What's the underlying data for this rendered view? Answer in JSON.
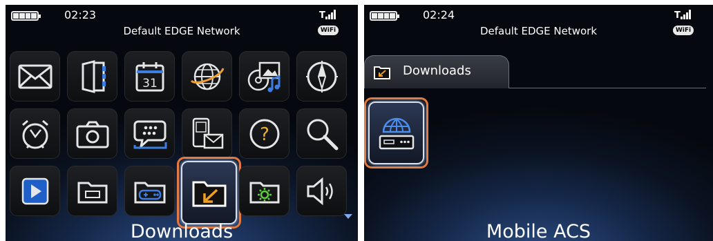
{
  "left_screen": {
    "status": {
      "time": "02:23",
      "network": "Default EDGE Network",
      "wifi_badge": "WiFi"
    },
    "apps": [
      {
        "row": 1,
        "items": [
          "envelope-icon",
          "contacts-book-icon",
          "calendar-icon",
          "browser-globe-icon",
          "media-icon",
          "compass-icon"
        ]
      },
      {
        "row": 2,
        "items": [
          "alarm-clock-icon",
          "camera-icon",
          "messenger-icon",
          "text-messages-icon",
          "help-question-icon",
          "search-icon"
        ]
      },
      {
        "row": 3,
        "items": [
          "play-video-icon",
          "folder-icon",
          "games-folder-icon",
          "downloads-folder-icon",
          "settings-folder-icon",
          "sound-icon"
        ]
      }
    ],
    "calendar_day": "31",
    "selected_app_label": "Downloads"
  },
  "right_screen": {
    "status": {
      "time": "02:24",
      "network": "Default EDGE Network",
      "wifi_badge": "WiFi"
    },
    "folder_tab": "Downloads",
    "selected_app_label": "Mobile ACS"
  },
  "colors": {
    "highlight": "#e8773a",
    "accent_blue": "#3d7ee0",
    "background": "#0b1322"
  }
}
